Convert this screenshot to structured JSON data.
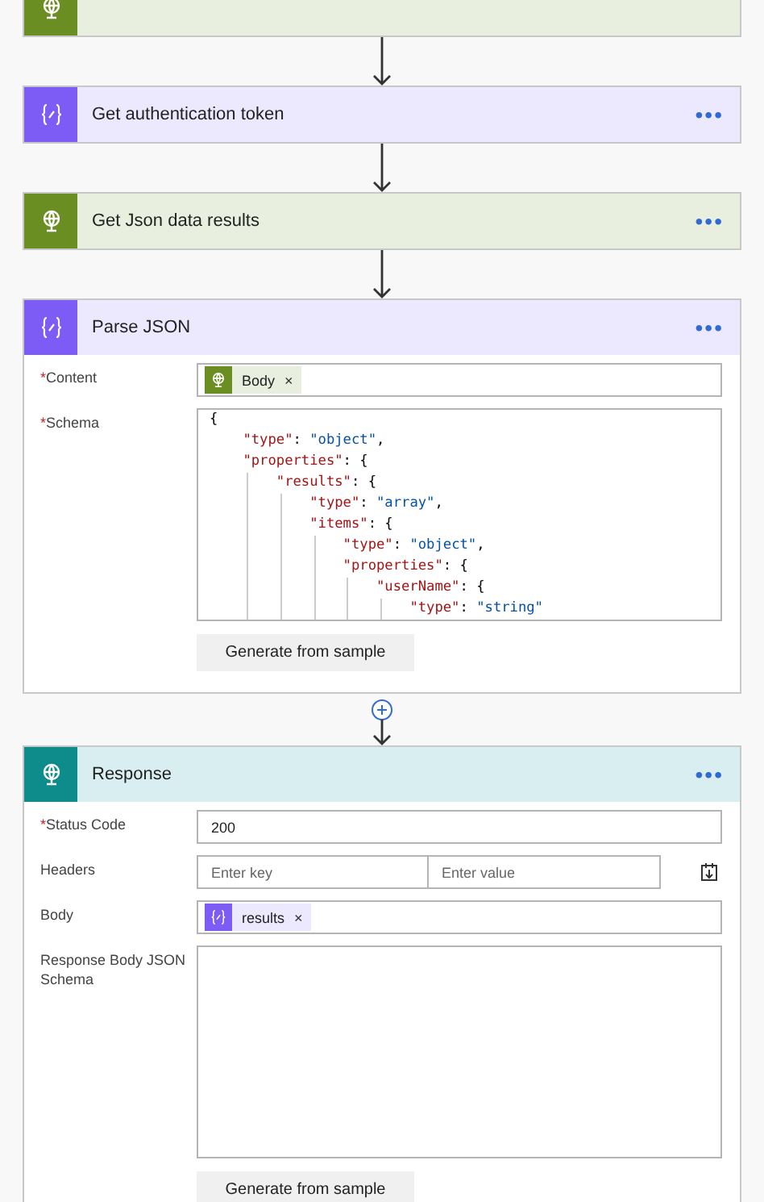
{
  "steps": [
    {
      "kind": "http"
    },
    {
      "kind": "variable",
      "title": "Get authentication token",
      "menu": "•••"
    },
    {
      "kind": "http",
      "title": "Get Json data results",
      "menu": "•••"
    },
    {
      "kind": "variable",
      "title": "Parse JSON",
      "menu": "•••",
      "fields": [
        {
          "kind": "tokens",
          "label": "Content",
          "mark": "*",
          "tokens": [
            {
              "kind": "http",
              "text": "Body",
              "remove": "×"
            }
          ]
        },
        {
          "kind": "code",
          "label": "Schema",
          "mark": "*",
          "lines": [
            "{",
            "    \"type\": \"object\",",
            "    \"properties\": {",
            "        \"results\": {",
            "            \"type\": \"array\",",
            "            \"items\": {",
            "                \"type\": \"object\",",
            "                \"properties\": {",
            "                    \"userName\": {",
            "                        \"type\": \"string\""
          ]
        }
      ],
      "button": "Generate from sample",
      "insert_before_next": true
    },
    {
      "kind": "response",
      "title": "Response",
      "menu": "•••",
      "fields": [
        {
          "kind": "text",
          "label": "Status Code",
          "mark": "*",
          "value": "200"
        },
        {
          "kind": "keyvalue",
          "label": "Headers",
          "key_placeholder": "Enter key",
          "value_placeholder": "Enter value"
        },
        {
          "kind": "tokens",
          "label": "Body",
          "tokens": [
            {
              "kind": "variable",
              "text": "results",
              "remove": "×"
            }
          ]
        },
        {
          "kind": "code",
          "label": "Response Body JSON Schema"
        }
      ],
      "button": "Generate from sample"
    }
  ]
}
